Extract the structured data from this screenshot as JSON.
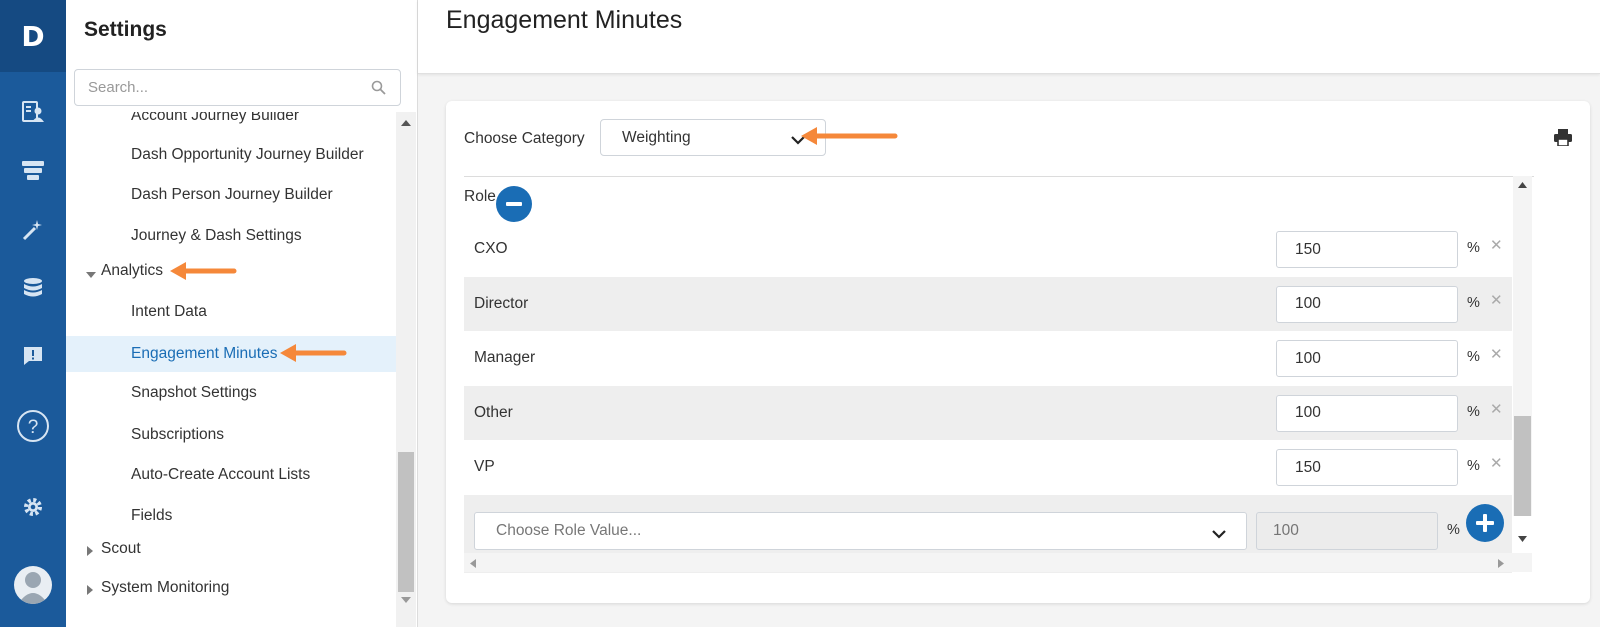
{
  "rail": {
    "logo": "D",
    "items": [
      "accounts-icon",
      "funnel-icon",
      "magic-wand-icon",
      "database-icon",
      "feedback-icon",
      "help-icon",
      "gear-icon",
      "avatar"
    ]
  },
  "settings": {
    "title": "Settings",
    "search_placeholder": "Search...",
    "tree": [
      {
        "label": "Account Journey Builder",
        "level": "sub"
      },
      {
        "label": "Dash Opportunity Journey Builder",
        "level": "sub"
      },
      {
        "label": "Dash Person Journey Builder",
        "level": "sub"
      },
      {
        "label": "Journey & Dash Settings",
        "level": "sub"
      },
      {
        "label": "Analytics",
        "level": "top",
        "expanded": true
      },
      {
        "label": "Intent Data",
        "level": "sub"
      },
      {
        "label": "Engagement Minutes",
        "level": "sub",
        "active": true
      },
      {
        "label": "Snapshot Settings",
        "level": "sub"
      },
      {
        "label": "Subscriptions",
        "level": "sub"
      },
      {
        "label": "Auto-Create Account Lists",
        "level": "sub"
      },
      {
        "label": "Fields",
        "level": "sub"
      },
      {
        "label": "Scout",
        "level": "top",
        "expanded": false
      },
      {
        "label": "System Monitoring",
        "level": "top",
        "expanded": false
      }
    ]
  },
  "main": {
    "page_title": "Engagement Minutes",
    "choose_category_label": "Choose Category",
    "category_value": "Weighting",
    "role_label": "Role",
    "rows": [
      {
        "name": "CXO",
        "value": "150",
        "unit": "%"
      },
      {
        "name": "Director",
        "value": "100",
        "unit": "%"
      },
      {
        "name": "Manager",
        "value": "100",
        "unit": "%"
      },
      {
        "name": "Other",
        "value": "100",
        "unit": "%"
      },
      {
        "name": "VP",
        "value": "150",
        "unit": "%"
      }
    ],
    "add_row": {
      "role_placeholder": "Choose Role Value...",
      "value_placeholder": "100",
      "unit": "%"
    }
  },
  "colors": {
    "rail": "#1b5a9b",
    "accent": "#1a6db5",
    "annotation_arrow": "#f5883a",
    "active_bg": "#e4f1fb"
  }
}
